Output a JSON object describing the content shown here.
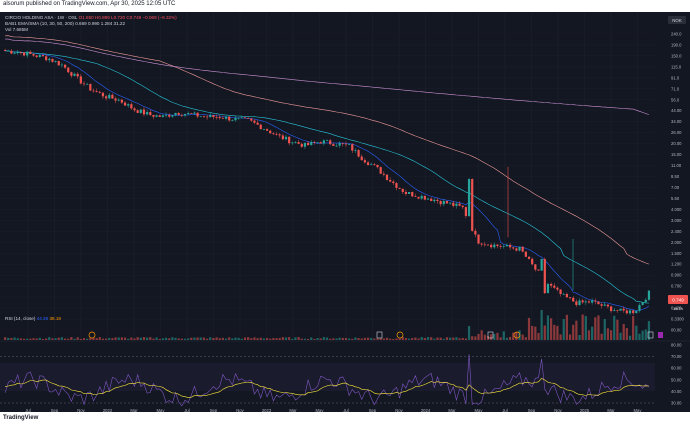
{
  "header": {
    "title": "alsorum published on TradingView.com, Apr 30, 2025 12:05 UTC"
  },
  "footer": {
    "brand": "TradingView"
  },
  "symbol": {
    "line": "CIRCIO HOLDING ASA · 1W · OSL",
    "ohlc": "O1.850  H0.899  L0.720  C0.749  −0.069 (−8.32%)",
    "ma_line": "BAB1 EMA/SMA (10, 30, 50, 200)  0.669  0.990  1.284  31.22",
    "vol_line": "Vol  7.685M"
  },
  "currency_badge": "NOK",
  "price_axis": [
    "240.0",
    "190.0",
    "150.0",
    "115.0",
    "91.0",
    "71.0",
    "56.0",
    "44.00",
    "34.00",
    "26.00",
    "20.00",
    "15.00",
    "11.00",
    "8.50",
    "7.00",
    "5.50",
    "4.000",
    "3.000",
    "2.400",
    "2.000",
    "1.500",
    "1.200",
    "0.900",
    "0.700",
    "0.540",
    "0.420",
    "0.3300",
    "00.00"
  ],
  "price_marker": "0.749",
  "price_marker_sub": "1d 7h",
  "rsi": {
    "label": "RSI (14, close)",
    "value1": "44.38",
    "value2": "38.19",
    "axis": [
      "80.00",
      "70.00",
      "60.00",
      "50.00",
      "40.00",
      "30.00"
    ]
  },
  "time_axis": [
    "Jul",
    "Sep",
    "Nov",
    "2022",
    "Mar",
    "May",
    "Jul",
    "Sep",
    "Nov",
    "2023",
    "Mar",
    "May",
    "Jul",
    "Sep",
    "Nov",
    "2024",
    "Mar",
    "May",
    "Jul",
    "Sep",
    "Nov",
    "2025",
    "Mar",
    "May"
  ],
  "chart_data": {
    "type": "candlestick",
    "title": "CIRCIO HOLDING ASA · 1W · OSL",
    "log_scale": true,
    "colors": {
      "up": "#26a69a",
      "down": "#ef5350",
      "ema10": "#2962ff",
      "sma30": "#26c6da",
      "sma50": "#ef9a9a",
      "sma200": "#ce93d8",
      "rsi": "#7e57c2"
    },
    "approx_close_path": [
      165,
      160,
      150,
      140,
      120,
      90,
      70,
      60,
      55,
      45,
      40,
      38,
      42,
      40,
      38,
      38,
      36,
      35,
      30,
      25,
      22,
      20,
      22,
      21,
      20,
      15,
      12,
      9,
      7,
      6.5,
      6,
      5.5,
      5,
      2.4,
      2.2,
      2.1,
      2.0,
      1.3,
      0.9,
      0.7,
      0.6,
      0.62,
      0.55,
      0.5,
      0.5,
      0.75
    ]
  }
}
